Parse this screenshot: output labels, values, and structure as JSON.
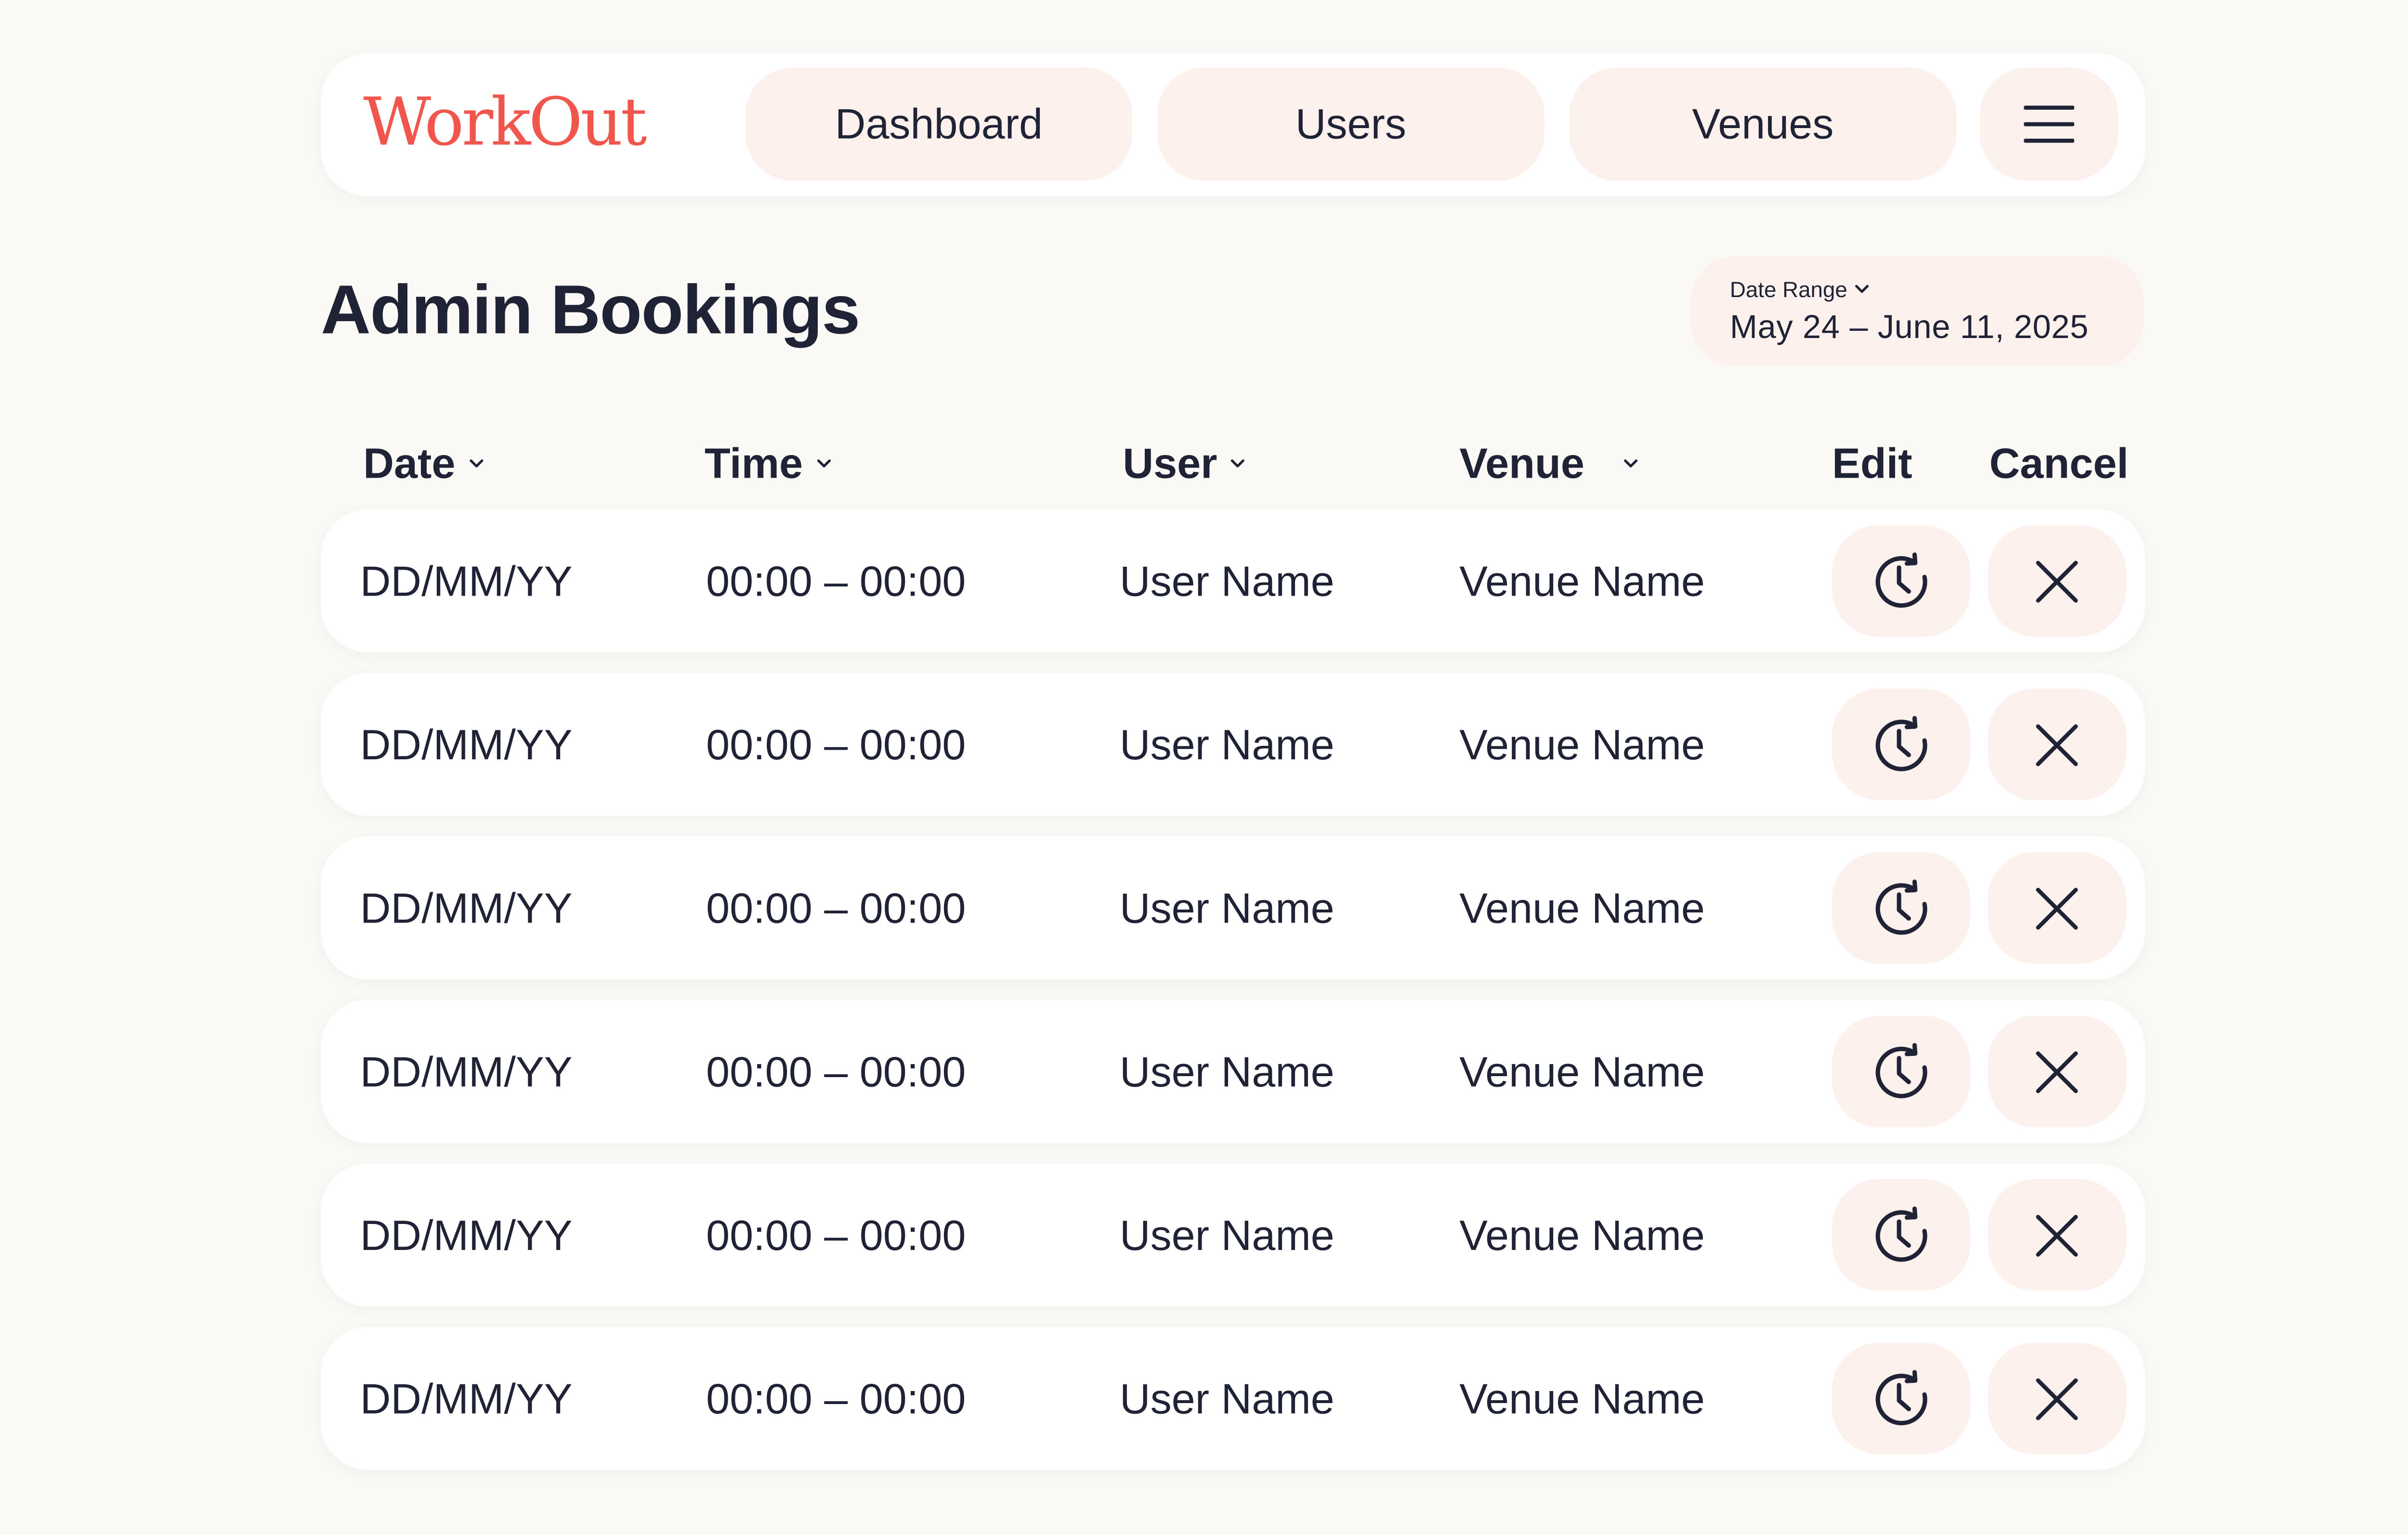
{
  "app": {
    "logo": "WorkOut"
  },
  "nav": {
    "items": [
      {
        "label": "Dashboard"
      },
      {
        "label": "Users"
      },
      {
        "label": "Venues"
      }
    ],
    "menu_icon": "hamburger-menu-icon"
  },
  "page": {
    "title": "Admin Bookings"
  },
  "date_range": {
    "label": "Date Range",
    "value": "May 24 – June 11, 2025",
    "icon": "chevron-down-icon"
  },
  "table": {
    "columns": [
      {
        "label": "Date",
        "sortable": true
      },
      {
        "label": "Time",
        "sortable": true
      },
      {
        "label": "User",
        "sortable": true
      },
      {
        "label": "Venue",
        "sortable": true
      },
      {
        "label": "Edit",
        "sortable": false
      },
      {
        "label": "Cancel",
        "sortable": false
      }
    ],
    "rows": [
      {
        "date": "DD/MM/YY",
        "time": "00:00 – 00:00",
        "user": "User Name",
        "venue": "Venue Name"
      },
      {
        "date": "DD/MM/YY",
        "time": "00:00 – 00:00",
        "user": "User Name",
        "venue": "Venue Name"
      },
      {
        "date": "DD/MM/YY",
        "time": "00:00 – 00:00",
        "user": "User Name",
        "venue": "Venue Name"
      },
      {
        "date": "DD/MM/YY",
        "time": "00:00 – 00:00",
        "user": "User Name",
        "venue": "Venue Name"
      },
      {
        "date": "DD/MM/YY",
        "time": "00:00 – 00:00",
        "user": "User Name",
        "venue": "Venue Name"
      },
      {
        "date": "DD/MM/YY",
        "time": "00:00 – 00:00",
        "user": "User Name",
        "venue": "Venue Name"
      }
    ],
    "edit_icon": "reschedule-clock-icon",
    "cancel_icon": "close-icon"
  },
  "colors": {
    "background": "#fbf9f6",
    "surface": "#ffffff",
    "pill": "#fcf1ec",
    "text": "#1f2335",
    "brand": "#f0564b"
  }
}
